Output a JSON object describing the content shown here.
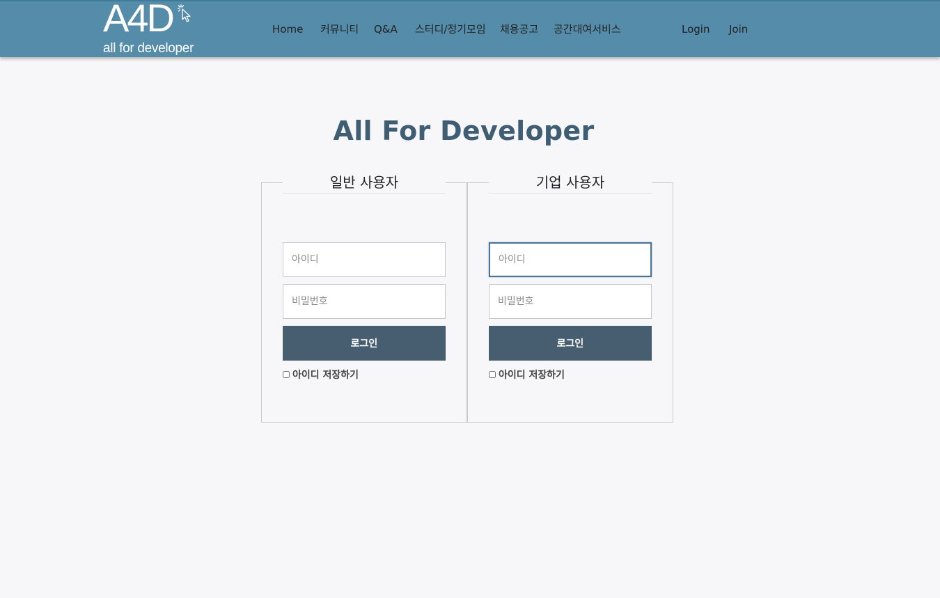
{
  "header": {
    "logo": {
      "main": "A4D",
      "sub": "all for developer"
    },
    "nav": [
      {
        "label": "Home"
      },
      {
        "label": "커뮤니티"
      },
      {
        "label": "Q&A"
      },
      {
        "label": "스터디/정기모임"
      },
      {
        "label": "채용공고"
      },
      {
        "label": "공간대여서비스"
      }
    ],
    "auth": {
      "login": "Login",
      "join": "Join"
    }
  },
  "page_title": "All For Developer",
  "panels": [
    {
      "title": "일반 사용자",
      "id_placeholder": "아이디",
      "pw_placeholder": "비밀번호",
      "button": "로그인",
      "remember": "아이디 저장하기"
    },
    {
      "title": "기업 사용자",
      "id_placeholder": "아이디",
      "pw_placeholder": "비밀번호",
      "button": "로그인",
      "remember": "아이디 저장하기"
    }
  ],
  "colors": {
    "header_bg": "#558ca9",
    "accent": "#475e70",
    "title": "#3f5d73",
    "focus": "#4a7396"
  }
}
